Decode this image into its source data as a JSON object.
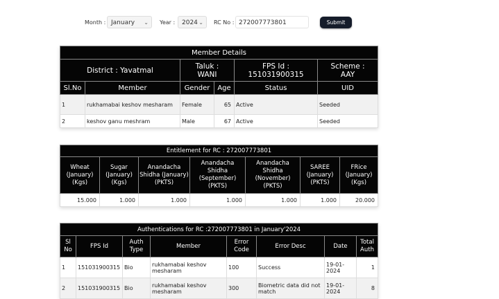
{
  "filter": {
    "month_label": "Month :",
    "month_value": "January",
    "year_label": "Year :",
    "year_value": "2024",
    "rc_label": "RC No :",
    "rc_value": "272007773801",
    "submit_label": "Submit",
    "dropdown_icon": "chevron-down-icon"
  },
  "member_details": {
    "title": "Member Details",
    "district": "District : Yavatmal",
    "taluk_label": "Taluk :",
    "taluk_value": "WANI",
    "fps_label": "FPS Id :",
    "fps_value": "151031900315",
    "scheme_label": "Scheme :",
    "scheme_value": "AAY",
    "columns": [
      "Sl.No",
      "Member",
      "Gender",
      "Age",
      "Status",
      "UID"
    ],
    "rows": [
      {
        "sl": "1",
        "member": "rukhamabai keshov mesharam",
        "gender": "Female",
        "age": "65",
        "status": "Active",
        "uid": "Seeded"
      },
      {
        "sl": "2",
        "member": "keshov ganu meshram",
        "gender": "Male",
        "age": "67",
        "status": "Active",
        "uid": "Seeded"
      }
    ]
  },
  "entitlement": {
    "title": "Entitlement for RC : 272007773801",
    "columns": [
      "Wheat (January) (Kgs)",
      "Sugar (January) (Kgs)",
      "Anandacha Shidha (January) (PKTS)",
      "Anandacha Shidha (September) (PKTS)",
      "Anandacha Shidha (November) (PKTS)",
      "SAREE (January) (PKTS)",
      "FRice (January) (Kgs)"
    ],
    "values": [
      "15.000",
      "1.000",
      "1.000",
      "1.000",
      "1.000",
      "1.000",
      "20.000"
    ]
  },
  "authentications": {
    "title": "Authentications for RC :272007773801 in January'2024",
    "columns": [
      "Sl No",
      "FPS Id",
      "Auth Type",
      "Member",
      "Error Code",
      "Error Desc",
      "Date",
      "Total Auth"
    ],
    "rows": [
      {
        "sl": "1",
        "fps": "151031900315",
        "type": "Bio",
        "member": "rukhamabai keshov mesharam",
        "code": "100",
        "desc": "Success",
        "date": "19-01-2024",
        "total": "1"
      },
      {
        "sl": "2",
        "fps": "151031900315",
        "type": "Bio",
        "member": "rukhamabai keshov mesharam",
        "code": "300",
        "desc": "Biometric data did not match",
        "date": "19-01-2024",
        "total": "8"
      }
    ]
  }
}
